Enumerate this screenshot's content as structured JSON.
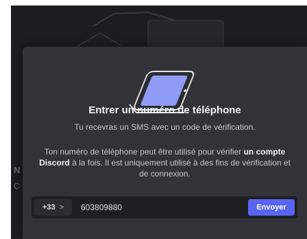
{
  "modal": {
    "title": "Entrer un numéro de téléphone",
    "subtitle": "Tu recevras un SMS avec un code de vérification.",
    "body_part1": "Ton numéro de téléphone peut être utilisé pour vérifier ",
    "body_bold": "un compte Discord",
    "body_part2": " à la fois. Il est uniquement utilisé à des fins de vérification et de connexion.",
    "country_code": "+33",
    "chevron": ">",
    "phone_value": "603809880",
    "send_label": "Envoyer",
    "illustration": "phone-illustration"
  },
  "background": {
    "left_text_a": "N",
    "left_text_b": "C"
  },
  "colors": {
    "modal_bg": "#313338",
    "input_bg": "#1e1f22",
    "accent": "#5865f2",
    "phone_fill": "#8f9bf7"
  }
}
